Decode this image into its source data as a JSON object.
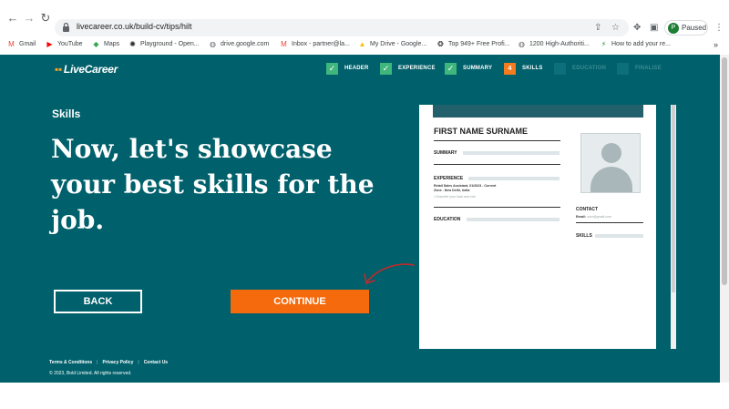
{
  "browser": {
    "url": "livecareer.co.uk/build-cv/tips/hilt",
    "profile_initial": "P",
    "profile_status": "Paused",
    "bookmarks": [
      {
        "label": "Gmail",
        "icon": "gmail-icon",
        "glyph": "M",
        "color": "#ea4335"
      },
      {
        "label": "YouTube",
        "icon": "youtube-icon",
        "glyph": "▶",
        "color": "#ff0000"
      },
      {
        "label": "Maps",
        "icon": "maps-icon",
        "glyph": "◆",
        "color": "#34a853"
      },
      {
        "label": "Playground - Open...",
        "icon": "openai-icon",
        "glyph": "✺",
        "color": "#202124"
      },
      {
        "label": "drive.google.com",
        "icon": "globe-icon",
        "glyph": "◍",
        "color": "#5f6368"
      },
      {
        "label": "Inbox - partner@la...",
        "icon": "gmail-icon",
        "glyph": "M",
        "color": "#ea4335"
      },
      {
        "label": "My Drive - Google...",
        "icon": "drive-icon",
        "glyph": "▲",
        "color": "#fbbc04"
      },
      {
        "label": "Top 949+ Free Profi...",
        "icon": "site-icon",
        "glyph": "❂",
        "color": "#202124"
      },
      {
        "label": "1200 High-Authoriti...",
        "icon": "globe-icon",
        "glyph": "◍",
        "color": "#5f6368"
      },
      {
        "label": "How to add your re...",
        "icon": "bolt-icon",
        "glyph": "⚡",
        "color": "#1e8e3e"
      }
    ],
    "more_bookmarks": "»"
  },
  "header": {
    "logo_text": "LiveCareer",
    "steps": [
      {
        "label": "HEADER",
        "state": "done",
        "marker": "✓"
      },
      {
        "label": "EXPERIENCE",
        "state": "done",
        "marker": "✓"
      },
      {
        "label": "SUMMARY",
        "state": "done",
        "marker": "✓"
      },
      {
        "label": "SKILLS",
        "state": "current",
        "marker": "4"
      },
      {
        "label": "EDUCATION",
        "state": "todo",
        "marker": ""
      },
      {
        "label": "FINALISE",
        "state": "todo",
        "marker": ""
      }
    ]
  },
  "main": {
    "section_label": "Skills",
    "headline": "Now, let's showcase your best skills for the job.",
    "back_label": "BACK",
    "continue_label": "CONTINUE"
  },
  "footer": {
    "terms": "Terms & Conditions",
    "privacy": "Privacy Policy",
    "contact": "Contact Us",
    "separator": "|",
    "copyright": "© 2023, Bold Limited. All rights reserved."
  },
  "resume_preview": {
    "name": "FIRST NAME SURNAME",
    "summary_heading": "SUMMARY",
    "experience_heading": "EXPERIENCE",
    "job_line": "Retail Sales Assistant, 01/2023 - Current",
    "location_line": "Zone - New Delhi, India",
    "job_description": "• Describe your task and role",
    "education_heading": "EDUCATION",
    "contact_heading": "CONTACT",
    "email_label": "Email:",
    "email_value": "user@gmail.com",
    "skills_heading": "SKILLS"
  },
  "colors": {
    "page_background": "#00606b",
    "accent": "#f46a0c",
    "step_done": "#3fb67b",
    "step_current": "#f47b20",
    "resume_band": "#22606c"
  }
}
